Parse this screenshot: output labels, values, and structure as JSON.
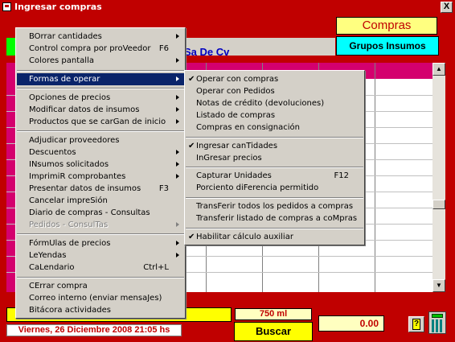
{
  "window": {
    "title": "Ingresar compras",
    "close_label": "X"
  },
  "header": {
    "compras_label": "Compras",
    "grupos_button": "Grupos Insumos",
    "heading_text": "Sa De Cv"
  },
  "footer": {
    "date_text": "Viernes, 26  Diciembre  2008  21:05 hs",
    "ml_text": "750 ml",
    "buscar_label": "Buscar",
    "total_value": "0.00"
  },
  "main_menu": {
    "items": [
      {
        "label": "BOrrar cantidades",
        "submenu": true
      },
      {
        "label": "Control compra por proVeedor",
        "shortcut": "F6"
      },
      {
        "label": "Colores pantalla",
        "submenu": true
      },
      {
        "label": "Formas de operar",
        "submenu": true,
        "selected": true
      },
      {
        "label": "Opciones de precios",
        "submenu": true
      },
      {
        "label": "Modificar datos de insumos",
        "submenu": true
      },
      {
        "label": "Productos que se carGan de inicio",
        "submenu": true
      },
      {
        "label": "Adjudicar proveedores"
      },
      {
        "label": "Descuentos",
        "submenu": true
      },
      {
        "label": "INsumos solicitados",
        "submenu": true
      },
      {
        "label": "ImprimiR comprobantes",
        "submenu": true
      },
      {
        "label": "Presentar datos de insumos",
        "shortcut": "F3"
      },
      {
        "label": "Cancelar impreSión"
      },
      {
        "label": "Diario de compras - Consultas"
      },
      {
        "label": "Pedidos - ConsulTas",
        "submenu": true,
        "disabled": true
      },
      {
        "label": "FórmUlas de precios",
        "submenu": true
      },
      {
        "label": "LeYendas",
        "submenu": true
      },
      {
        "label": "CaLendario",
        "shortcut": "Ctrl+L"
      },
      {
        "label": "CErrar compra"
      },
      {
        "label": "Correo interno (enviar mensaJes)"
      },
      {
        "label": "Bitácora actividades"
      }
    ]
  },
  "sub_menu": {
    "items": [
      {
        "label": "Operar con compras",
        "checked": true
      },
      {
        "label": "Operar con Pedidos"
      },
      {
        "label": "Notas de crédito (devoluciones)"
      },
      {
        "label": "Listado de compras"
      },
      {
        "label": "Compras en consignación"
      },
      {
        "label": "Ingresar canTidades",
        "checked": true
      },
      {
        "label": "InGresar precios"
      },
      {
        "label": "Capturar Unidades",
        "shortcut": "F12"
      },
      {
        "label": "Porciento diFerencia permitido"
      },
      {
        "label": "TransFerir todos los pedidos a compras"
      },
      {
        "label": "Transferir listado de compras a coMpras"
      },
      {
        "label": "Habilitar cálculo auxiliar",
        "checked": true
      }
    ]
  },
  "icons": {
    "check": "checkmark-icon",
    "submenu": "submenu-arrow-icon"
  },
  "colors": {
    "window_bg": "#c00000",
    "menu_highlight": "#0a246a",
    "grid_header": "#d4006e"
  }
}
